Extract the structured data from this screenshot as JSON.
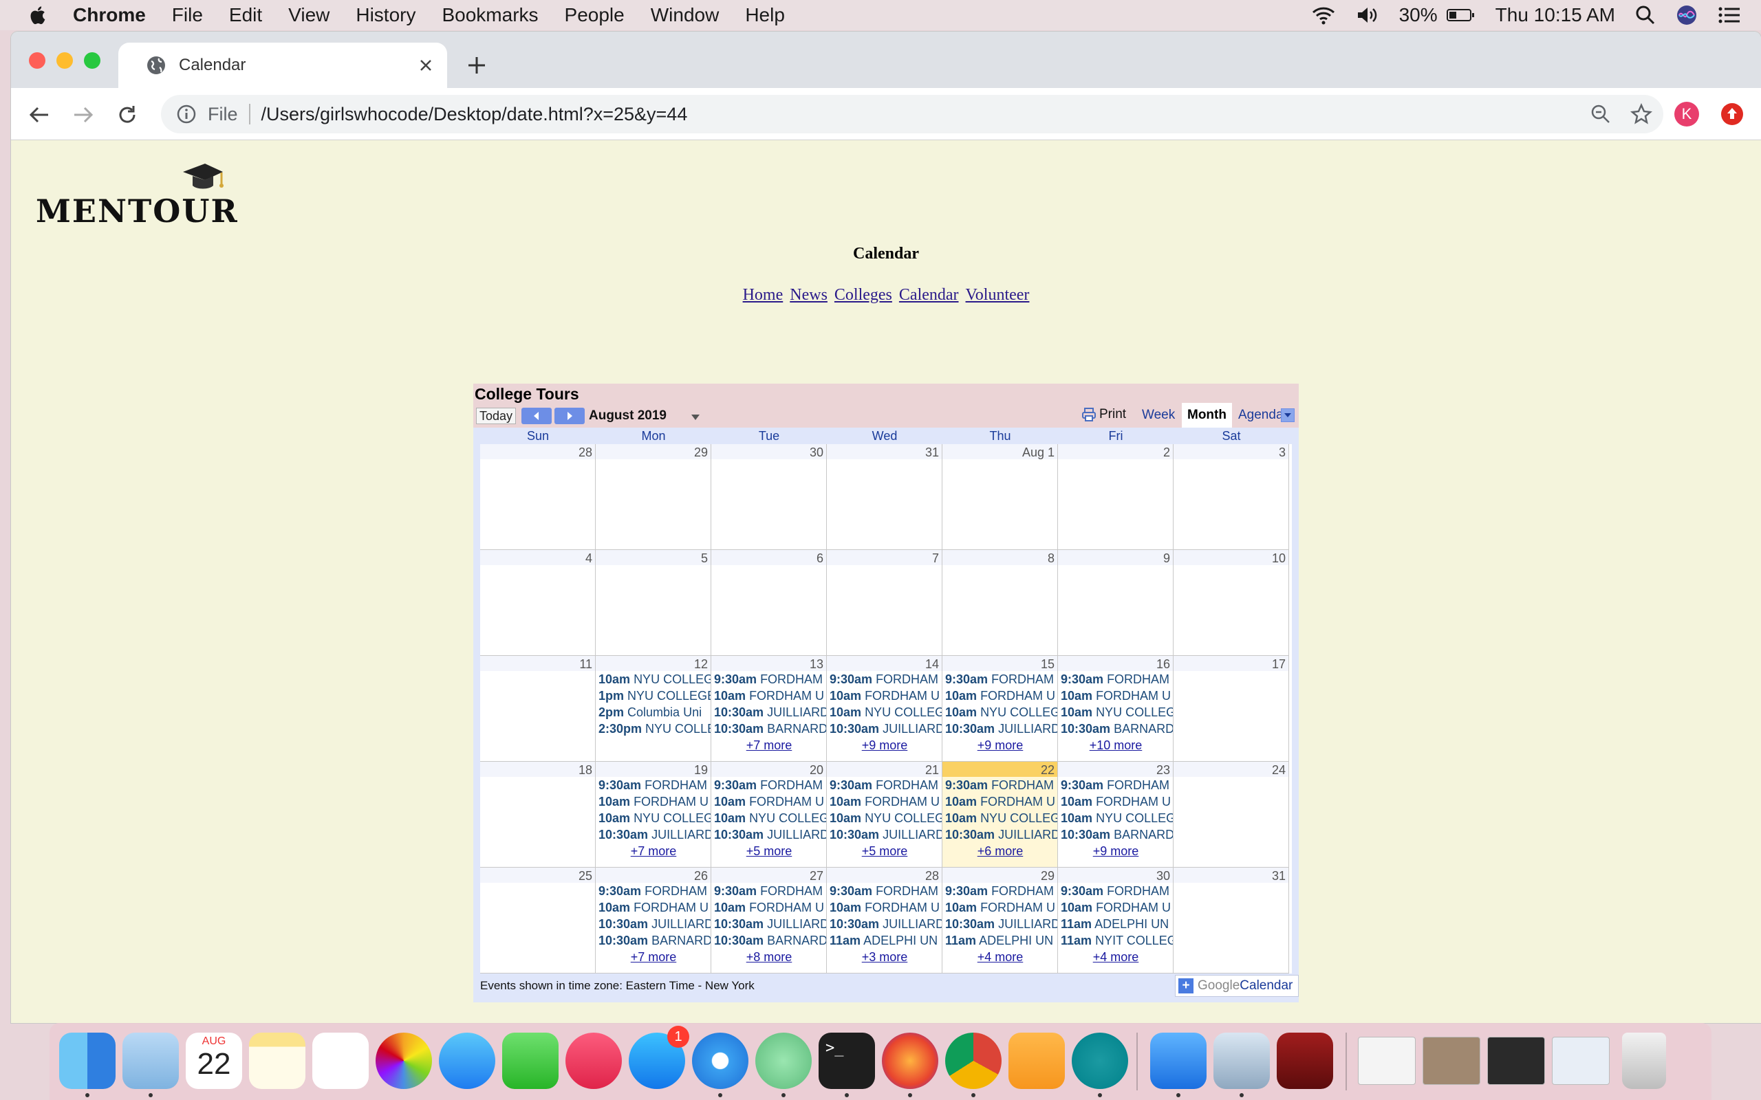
{
  "menubar": {
    "app": "Chrome",
    "items": [
      "File",
      "Edit",
      "View",
      "History",
      "Bookmarks",
      "People",
      "Window",
      "Help"
    ],
    "battery": "30%",
    "clock": "Thu 10:15 AM"
  },
  "browser": {
    "tab_title": "Calendar",
    "scheme": "File",
    "url": "/Users/girlswhocode/Desktop/date.html?x=25&y=44",
    "profile_initial": "K"
  },
  "page": {
    "logo": "MENTOUR",
    "title": "Calendar",
    "nav": [
      "Home",
      "News",
      "Colleges",
      "Calendar",
      "Volunteer"
    ]
  },
  "calendar": {
    "title": "College Tours",
    "today_label": "Today",
    "month_label": "August 2019",
    "print_label": "Print",
    "views": [
      "Week",
      "Month",
      "Agenda"
    ],
    "active_view": "Month",
    "days_of_week": [
      "Sun",
      "Mon",
      "Tue",
      "Wed",
      "Thu",
      "Fri",
      "Sat"
    ],
    "footer": "Events shown in time zone: Eastern Time - New York",
    "brand_google": "Google",
    "brand_calendar": "Calendar",
    "weeks": [
      [
        {
          "day": "28",
          "events": [],
          "more": ""
        },
        {
          "day": "29",
          "events": [],
          "more": ""
        },
        {
          "day": "30",
          "events": [],
          "more": ""
        },
        {
          "day": "31",
          "events": [],
          "more": ""
        },
        {
          "day": "Aug 1",
          "events": [],
          "more": ""
        },
        {
          "day": "2",
          "events": [],
          "more": ""
        },
        {
          "day": "3",
          "events": [],
          "more": ""
        }
      ],
      [
        {
          "day": "4",
          "events": [],
          "more": ""
        },
        {
          "day": "5",
          "events": [],
          "more": ""
        },
        {
          "day": "6",
          "events": [],
          "more": ""
        },
        {
          "day": "7",
          "events": [],
          "more": ""
        },
        {
          "day": "8",
          "events": [],
          "more": ""
        },
        {
          "day": "9",
          "events": [],
          "more": ""
        },
        {
          "day": "10",
          "events": [],
          "more": ""
        }
      ],
      [
        {
          "day": "11",
          "events": [],
          "more": ""
        },
        {
          "day": "12",
          "events": [
            {
              "time": "10am",
              "name": "NYU COLLEG"
            },
            {
              "time": "1pm",
              "name": "NYU COLLEGE"
            },
            {
              "time": "2pm",
              "name": "Columbia Uni"
            },
            {
              "time": "2:30pm",
              "name": "NYU COLLE"
            }
          ],
          "more": ""
        },
        {
          "day": "13",
          "events": [
            {
              "time": "9:30am",
              "name": "FORDHAM"
            },
            {
              "time": "10am",
              "name": "FORDHAM U"
            },
            {
              "time": "10:30am",
              "name": "JUILLIARD"
            },
            {
              "time": "10:30am",
              "name": "BARNARD"
            }
          ],
          "more": "+7 more"
        },
        {
          "day": "14",
          "events": [
            {
              "time": "9:30am",
              "name": "FORDHAM"
            },
            {
              "time": "10am",
              "name": "FORDHAM U"
            },
            {
              "time": "10am",
              "name": "NYU COLLEG"
            },
            {
              "time": "10:30am",
              "name": "JUILLIARD"
            }
          ],
          "more": "+9 more"
        },
        {
          "day": "15",
          "events": [
            {
              "time": "9:30am",
              "name": "FORDHAM"
            },
            {
              "time": "10am",
              "name": "FORDHAM U"
            },
            {
              "time": "10am",
              "name": "NYU COLLEG"
            },
            {
              "time": "10:30am",
              "name": "JUILLIARD"
            }
          ],
          "more": "+9 more"
        },
        {
          "day": "16",
          "events": [
            {
              "time": "9:30am",
              "name": "FORDHAM"
            },
            {
              "time": "10am",
              "name": "FORDHAM U"
            },
            {
              "time": "10am",
              "name": "NYU COLLEG"
            },
            {
              "time": "10:30am",
              "name": "BARNARD"
            }
          ],
          "more": "+10 more"
        },
        {
          "day": "17",
          "events": [],
          "more": ""
        }
      ],
      [
        {
          "day": "18",
          "events": [],
          "more": ""
        },
        {
          "day": "19",
          "events": [
            {
              "time": "9:30am",
              "name": "FORDHAM"
            },
            {
              "time": "10am",
              "name": "FORDHAM U"
            },
            {
              "time": "10am",
              "name": "NYU COLLEG"
            },
            {
              "time": "10:30am",
              "name": "JUILLIARD"
            }
          ],
          "more": "+7 more"
        },
        {
          "day": "20",
          "events": [
            {
              "time": "9:30am",
              "name": "FORDHAM"
            },
            {
              "time": "10am",
              "name": "FORDHAM U"
            },
            {
              "time": "10am",
              "name": "NYU COLLEG"
            },
            {
              "time": "10:30am",
              "name": "JUILLIARD"
            }
          ],
          "more": "+5 more"
        },
        {
          "day": "21",
          "events": [
            {
              "time": "9:30am",
              "name": "FORDHAM"
            },
            {
              "time": "10am",
              "name": "FORDHAM U"
            },
            {
              "time": "10am",
              "name": "NYU COLLEG"
            },
            {
              "time": "10:30am",
              "name": "JUILLIARD"
            }
          ],
          "more": "+5 more"
        },
        {
          "day": "22",
          "events": [
            {
              "time": "9:30am",
              "name": "FORDHAM"
            },
            {
              "time": "10am",
              "name": "FORDHAM U"
            },
            {
              "time": "10am",
              "name": "NYU COLLEG"
            },
            {
              "time": "10:30am",
              "name": "JUILLIARD"
            }
          ],
          "more": "+6 more",
          "today": true
        },
        {
          "day": "23",
          "events": [
            {
              "time": "9:30am",
              "name": "FORDHAM"
            },
            {
              "time": "10am",
              "name": "FORDHAM U"
            },
            {
              "time": "10am",
              "name": "NYU COLLEG"
            },
            {
              "time": "10:30am",
              "name": "BARNARD"
            }
          ],
          "more": "+9 more"
        },
        {
          "day": "24",
          "events": [],
          "more": ""
        }
      ],
      [
        {
          "day": "25",
          "events": [],
          "more": ""
        },
        {
          "day": "26",
          "events": [
            {
              "time": "9:30am",
              "name": "FORDHAM"
            },
            {
              "time": "10am",
              "name": "FORDHAM U"
            },
            {
              "time": "10:30am",
              "name": "JUILLIARD"
            },
            {
              "time": "10:30am",
              "name": "BARNARD"
            }
          ],
          "more": "+7 more"
        },
        {
          "day": "27",
          "events": [
            {
              "time": "9:30am",
              "name": "FORDHAM"
            },
            {
              "time": "10am",
              "name": "FORDHAM U"
            },
            {
              "time": "10:30am",
              "name": "JUILLIARD"
            },
            {
              "time": "10:30am",
              "name": "BARNARD"
            }
          ],
          "more": "+8 more"
        },
        {
          "day": "28",
          "events": [
            {
              "time": "9:30am",
              "name": "FORDHAM"
            },
            {
              "time": "10am",
              "name": "FORDHAM U"
            },
            {
              "time": "10:30am",
              "name": "JUILLIARD"
            },
            {
              "time": "11am",
              "name": "ADELPHI UN"
            }
          ],
          "more": "+3 more"
        },
        {
          "day": "29",
          "events": [
            {
              "time": "9:30am",
              "name": "FORDHAM"
            },
            {
              "time": "10am",
              "name": "FORDHAM U"
            },
            {
              "time": "10:30am",
              "name": "JUILLIARD"
            },
            {
              "time": "11am",
              "name": "ADELPHI UN"
            }
          ],
          "more": "+4 more"
        },
        {
          "day": "30",
          "events": [
            {
              "time": "9:30am",
              "name": "FORDHAM"
            },
            {
              "time": "10am",
              "name": "FORDHAM U"
            },
            {
              "time": "11am",
              "name": "ADELPHI UN"
            },
            {
              "time": "11am",
              "name": "NYIT COLLEG"
            }
          ],
          "more": "+4 more"
        },
        {
          "day": "31",
          "events": [],
          "more": ""
        }
      ]
    ]
  },
  "dock": {
    "calendar_month": "AUG",
    "calendar_day": "22",
    "appstore_badge": "1",
    "apps": [
      "finder-icon",
      "mail-icon",
      "calendar-icon",
      "notes-icon",
      "reminders-icon",
      "photos-icon",
      "messages-icon",
      "facetime-icon",
      "music-icon",
      "app-store-icon",
      "safari-icon",
      "atom-icon",
      "terminal-icon",
      "firefox-icon",
      "chrome-icon",
      "scratch-icon",
      "arduino-icon",
      "xcode-icon",
      "preview-icon",
      "flash-icon"
    ]
  },
  "colors": {
    "page_bg": "#f4f4dc",
    "cal_header": "#ebd4d6",
    "today_highlight": "#fad163",
    "event_text": "#1d4b7a"
  }
}
